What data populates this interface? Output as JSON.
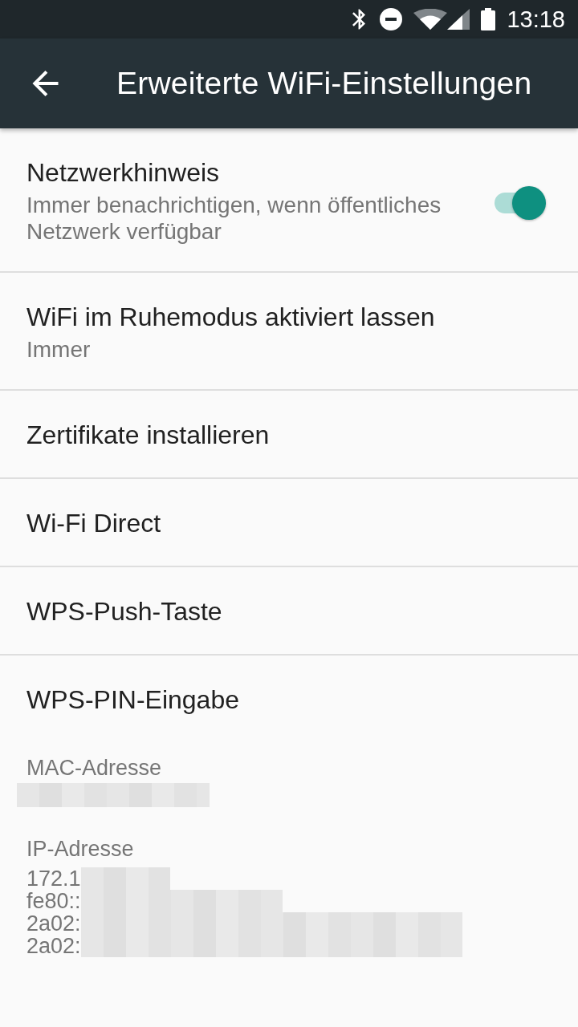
{
  "status_bar": {
    "time": "13:18"
  },
  "app_bar": {
    "title": "Erweiterte WiFi-Einstellungen"
  },
  "settings": [
    {
      "kind": "switch",
      "title": "Netzwerkhinweis",
      "summary": "Immer benachrichtigen, wenn öffentliches Netzwerk verfügbar",
      "on": true
    },
    {
      "kind": "plain",
      "title": "WiFi im Ruhemodus aktiviert lassen",
      "summary": "Immer"
    },
    {
      "kind": "plain",
      "title": "Zertifikate installieren"
    },
    {
      "kind": "plain",
      "title": "Wi-Fi Direct"
    },
    {
      "kind": "plain",
      "title": "WPS-Push-Taste"
    },
    {
      "kind": "plain",
      "title": "WPS-PIN-Eingabe"
    }
  ],
  "info": [
    {
      "label": "MAC-Adresse",
      "lines": [
        {
          "redacted": true
        }
      ]
    },
    {
      "label": "IP-Adresse",
      "lines": [
        {
          "text": "172.1",
          "redacted": true
        },
        {
          "text": "fe80::",
          "redacted": true
        },
        {
          "text": "2a02:",
          "redacted": true
        },
        {
          "text": "2a02:",
          "redacted": true
        }
      ]
    }
  ]
}
